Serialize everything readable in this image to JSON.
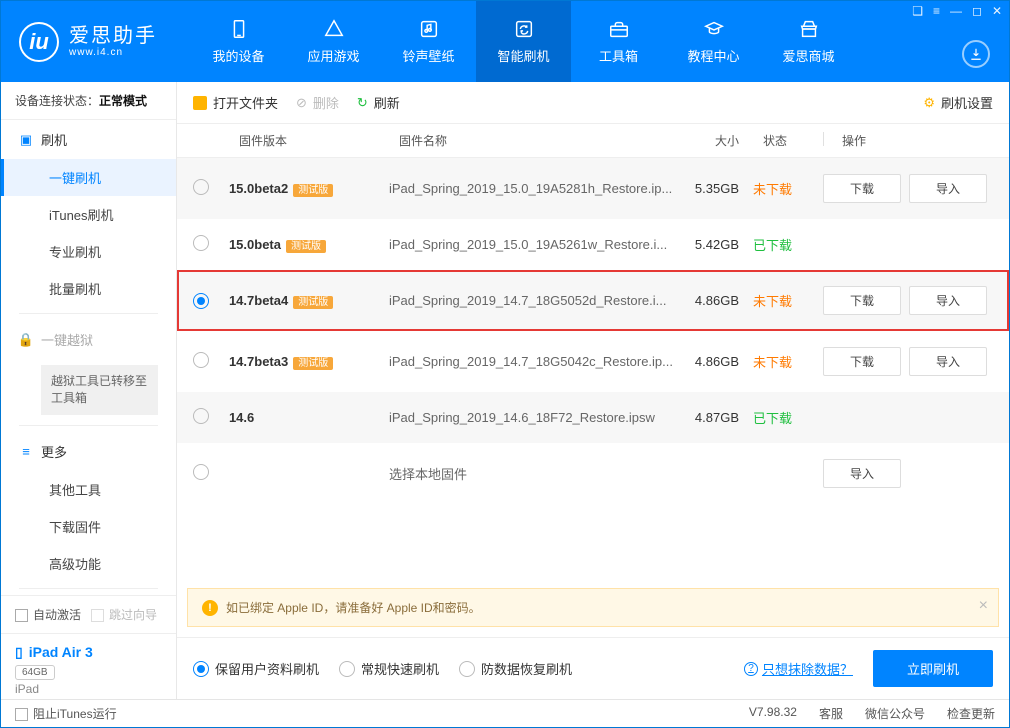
{
  "app": {
    "name": "爱思助手",
    "url": "www.i4.cn"
  },
  "win_buttons": [
    "❑",
    "≡",
    "—",
    "◻",
    "✕"
  ],
  "topnav": [
    {
      "label": "我的设备",
      "icon": "phone"
    },
    {
      "label": "应用游戏",
      "icon": "apps"
    },
    {
      "label": "铃声壁纸",
      "icon": "music"
    },
    {
      "label": "智能刷机",
      "icon": "refresh",
      "active": true
    },
    {
      "label": "工具箱",
      "icon": "toolbox"
    },
    {
      "label": "教程中心",
      "icon": "grad"
    },
    {
      "label": "爱思商城",
      "icon": "store"
    }
  ],
  "sidebar": {
    "connection": {
      "label": "设备连接状态：",
      "value": "正常模式"
    },
    "groups": [
      {
        "icon": "flash",
        "title": "刷机",
        "items": [
          {
            "label": "一键刷机",
            "active": true
          },
          {
            "label": "iTunes刷机"
          },
          {
            "label": "专业刷机"
          },
          {
            "label": "批量刷机"
          }
        ]
      },
      {
        "icon": "lock",
        "title": "一键越狱",
        "disabled": true,
        "note": "越狱工具已转移至工具箱"
      },
      {
        "icon": "more",
        "title": "更多",
        "items": [
          {
            "label": "其他工具"
          },
          {
            "label": "下载固件"
          },
          {
            "label": "高级功能"
          }
        ]
      }
    ],
    "auto_activate": "自动激活",
    "skip_guide": "跳过向导",
    "device": {
      "name": "iPad Air 3",
      "storage": "64GB",
      "type": "iPad"
    }
  },
  "toolbar": {
    "open": "打开文件夹",
    "delete": "删除",
    "refresh": "刷新",
    "settings": "刷机设置"
  },
  "columns": {
    "version": "固件版本",
    "name": "固件名称",
    "size": "大小",
    "status": "状态",
    "ops": "操作"
  },
  "ops": {
    "download": "下载",
    "import": "导入"
  },
  "status_labels": {
    "not": "未下载",
    "done": "已下载"
  },
  "beta_tag": "测试版",
  "rows": [
    {
      "ver": "15.0beta2",
      "beta": true,
      "name": "iPad_Spring_2019_15.0_19A5281h_Restore.ip...",
      "size": "5.35GB",
      "status": "not",
      "ops": [
        "download",
        "import"
      ],
      "alt": true
    },
    {
      "ver": "15.0beta",
      "beta": true,
      "name": "iPad_Spring_2019_15.0_19A5261w_Restore.i...",
      "size": "5.42GB",
      "status": "done"
    },
    {
      "ver": "14.7beta4",
      "beta": true,
      "name": "iPad_Spring_2019_14.7_18G5052d_Restore.i...",
      "size": "4.86GB",
      "status": "not",
      "ops": [
        "download",
        "import"
      ],
      "alt": true,
      "selected": true,
      "highlight": true
    },
    {
      "ver": "14.7beta3",
      "beta": true,
      "name": "iPad_Spring_2019_14.7_18G5042c_Restore.ip...",
      "size": "4.86GB",
      "status": "not",
      "ops": [
        "download",
        "import"
      ]
    },
    {
      "ver": "14.6",
      "beta": false,
      "name": "iPad_Spring_2019_14.6_18F72_Restore.ipsw",
      "size": "4.87GB",
      "status": "done",
      "alt": true
    },
    {
      "local": true,
      "name": "选择本地固件",
      "ops": [
        "import"
      ]
    }
  ],
  "notice": "如已绑定 Apple ID，请准备好 Apple ID和密码。",
  "actionbar": {
    "options": [
      {
        "label": "保留用户资料刷机",
        "sel": true
      },
      {
        "label": "常规快速刷机"
      },
      {
        "label": "防数据恢复刷机"
      }
    ],
    "link": "只想抹除数据？",
    "primary": "立即刷机"
  },
  "statusbar": {
    "block": "阻止iTunes运行",
    "version": "V7.98.32",
    "service": "客服",
    "wechat": "微信公众号",
    "update": "检查更新"
  }
}
